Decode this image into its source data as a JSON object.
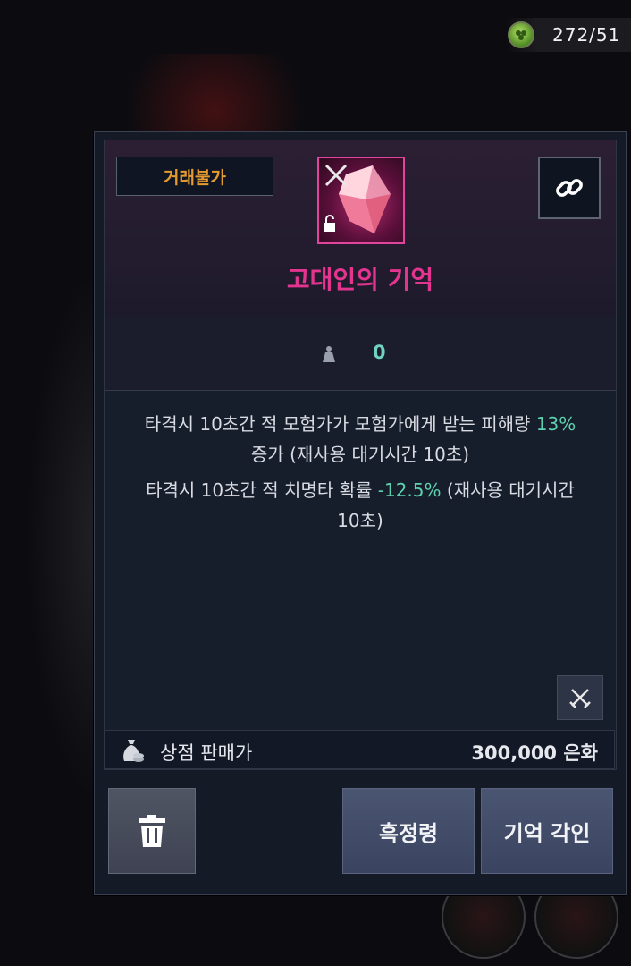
{
  "hud": {
    "counter_icon": "clover-coin-icon",
    "counter_text": "272/51"
  },
  "item": {
    "trade_status": "거래불가",
    "name": "고대인의 기억",
    "name_color": "#e3348f",
    "icon": "pink-crystal-icon",
    "stat_icon": "weight-icon",
    "stat_value": "0"
  },
  "description": {
    "line1_prefix": "타격시 10초간 적 모험가가 모험가에게 받는 피해량 ",
    "line1_value": "13%",
    "line1_suffix": " 증가 (재사용 대기시간 10초)",
    "line2_prefix": "타격시 10초간 적 치명타 확률 ",
    "line2_value": "-12.5%",
    "line2_suffix": " (재사용 대기시간 10초)"
  },
  "price": {
    "label": "상점 판매가",
    "value": "300,000 은화"
  },
  "buttons": {
    "delete_icon": "trash-icon",
    "black_label": "흑정령",
    "engrave_label": "기억 각인"
  }
}
